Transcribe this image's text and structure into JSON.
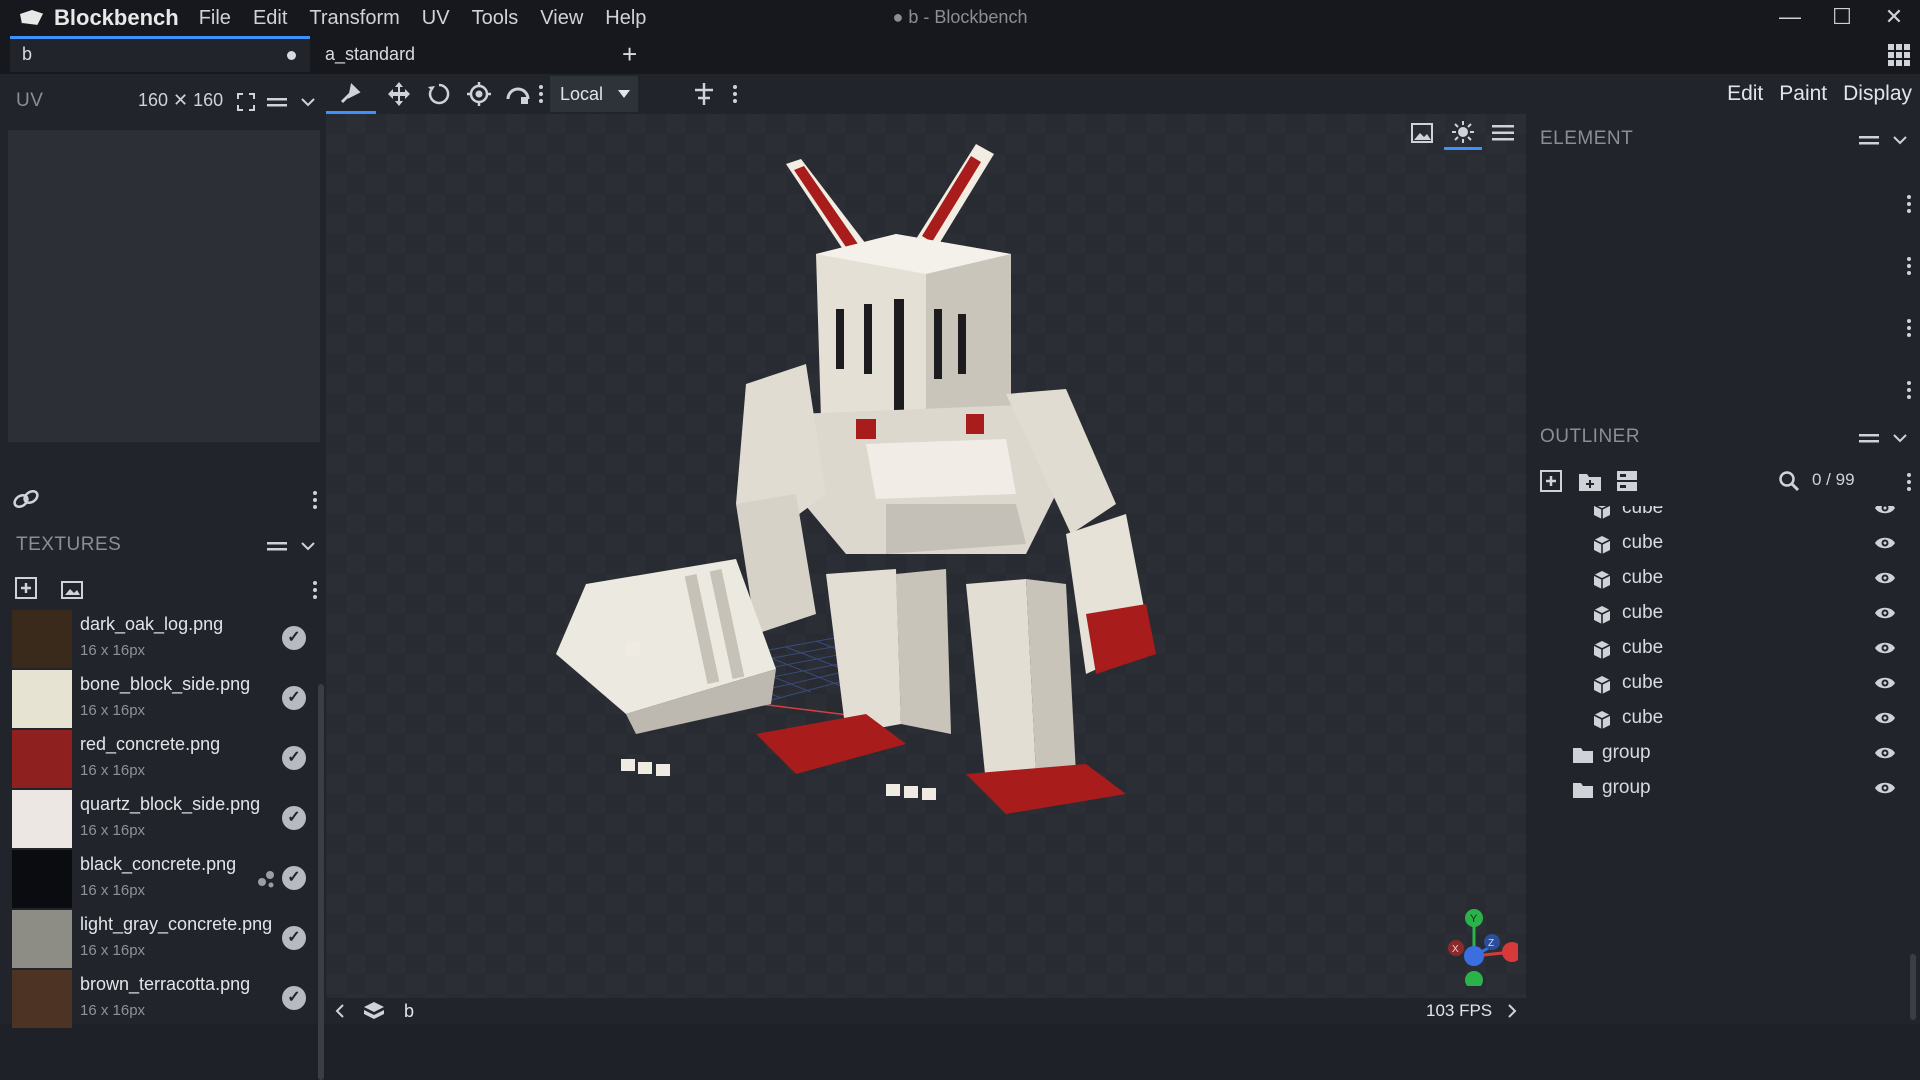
{
  "app": {
    "brand": "Blockbench",
    "window_title": "● b - Blockbench",
    "menu": [
      "File",
      "Edit",
      "Transform",
      "UV",
      "Tools",
      "View",
      "Help"
    ]
  },
  "tabs": [
    {
      "label": "b",
      "active": true,
      "unsaved": true
    },
    {
      "label": "a_standard",
      "active": false
    }
  ],
  "uv_panel": {
    "title": "UV",
    "size": "160 ✕ 160"
  },
  "textures_panel": {
    "title": "TEXTURES",
    "items": [
      {
        "name": "dark_oak_log.png",
        "size": "16 x 16px",
        "color": "#3a2a1b"
      },
      {
        "name": "bone_block_side.png",
        "size": "16 x 16px",
        "color": "#e6e3d2"
      },
      {
        "name": "red_concrete.png",
        "size": "16 x 16px",
        "color": "#8e2020"
      },
      {
        "name": "quartz_block_side.png",
        "size": "16 x 16px",
        "color": "#ece7e2"
      },
      {
        "name": "black_concrete.png",
        "size": "16 x 16px",
        "color": "#0b0c10"
      },
      {
        "name": "light_gray_concrete.png",
        "size": "16 x 16px",
        "color": "#8d8d86"
      },
      {
        "name": "brown_terracotta.png",
        "size": "16 x 16px",
        "color": "#4d3324"
      }
    ]
  },
  "toolbar": {
    "pivot_mode": "Local"
  },
  "modes": [
    "Edit",
    "Paint",
    "Display"
  ],
  "element_panel": {
    "title": "ELEMENT"
  },
  "outliner": {
    "title": "OUTLINER",
    "count": "0 / 99",
    "items": [
      {
        "type": "cube",
        "label": "cube"
      },
      {
        "type": "cube",
        "label": "cube"
      },
      {
        "type": "cube",
        "label": "cube"
      },
      {
        "type": "cube",
        "label": "cube"
      },
      {
        "type": "cube",
        "label": "cube"
      },
      {
        "type": "cube",
        "label": "cube"
      },
      {
        "type": "cube",
        "label": "cube"
      },
      {
        "type": "group",
        "label": "group"
      },
      {
        "type": "group",
        "label": "group"
      }
    ]
  },
  "statusbar": {
    "model_name": "b",
    "fps": "103 FPS"
  },
  "axis_gizmo": {
    "labels": [
      "Y",
      "X",
      "Z"
    ]
  }
}
